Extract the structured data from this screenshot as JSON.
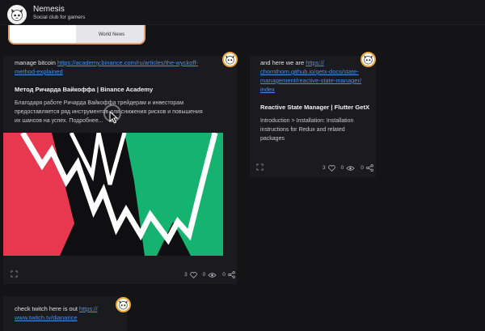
{
  "app": {
    "name": "Nemesis",
    "tagline": "Social club for gamers"
  },
  "previous_card": {
    "tag": "World News"
  },
  "posts": [
    {
      "text_prefix": "manage bitcoin ",
      "link": "https://academy.binance.com/ru/articles/the-wyckoff-method-explained",
      "link_line1": "https://academy.binance.com/ru/articles/the-wyckoff-",
      "link_line2": "method-explained",
      "preview_title": "Метод Ричарда Вайкоффа | Binance Academy",
      "preview_desc_line1": "Благодаря работе Ричарда Вайкоффа трейдерам и инвесторам",
      "preview_desc_line2": "предоставляется ряд инструментов для снижения рисков и повышения",
      "preview_desc_line3": "их шансов на успех. Подробнее...",
      "likes": "3",
      "views": "0",
      "shares": "0",
      "image_colors": {
        "red": "#e8384f",
        "green": "#15b36f",
        "black": "#0f0f12",
        "white": "#ffffff"
      }
    },
    {
      "text_prefix": "and here we are ",
      "link": "https://chornthorn.github.io/getx-docs/state-management/reactive-state-manager/index",
      "link_line1": "https://",
      "link_line2": "chornthorn.github.io/getx-docs/state-",
      "link_line3": "management/reactive-state-manager/",
      "link_line4": "index",
      "preview_title": "Reactive State Manager | Flutter GetX",
      "preview_desc_line1": "Introduction > Installation: Installation",
      "preview_desc_line2": "instructions for Redux and related",
      "preview_desc_line3": "packages",
      "likes": "3",
      "views": "0",
      "shares": "0"
    },
    {
      "text_prefix": "check twitch here is out ",
      "link_line1": "https://",
      "link_line2": "www.twitch.tv/dianarice"
    }
  ],
  "colors": {
    "background": "#141417",
    "card": "#1a1a1f",
    "link": "#4e8fe6",
    "avatar_ring": "#e8a83a"
  },
  "icons": [
    "nemesis-logo-icon",
    "user-avatar-icon",
    "expand-icon",
    "heart-icon",
    "eye-icon",
    "share-icon",
    "mouse-cursor-icon"
  ]
}
